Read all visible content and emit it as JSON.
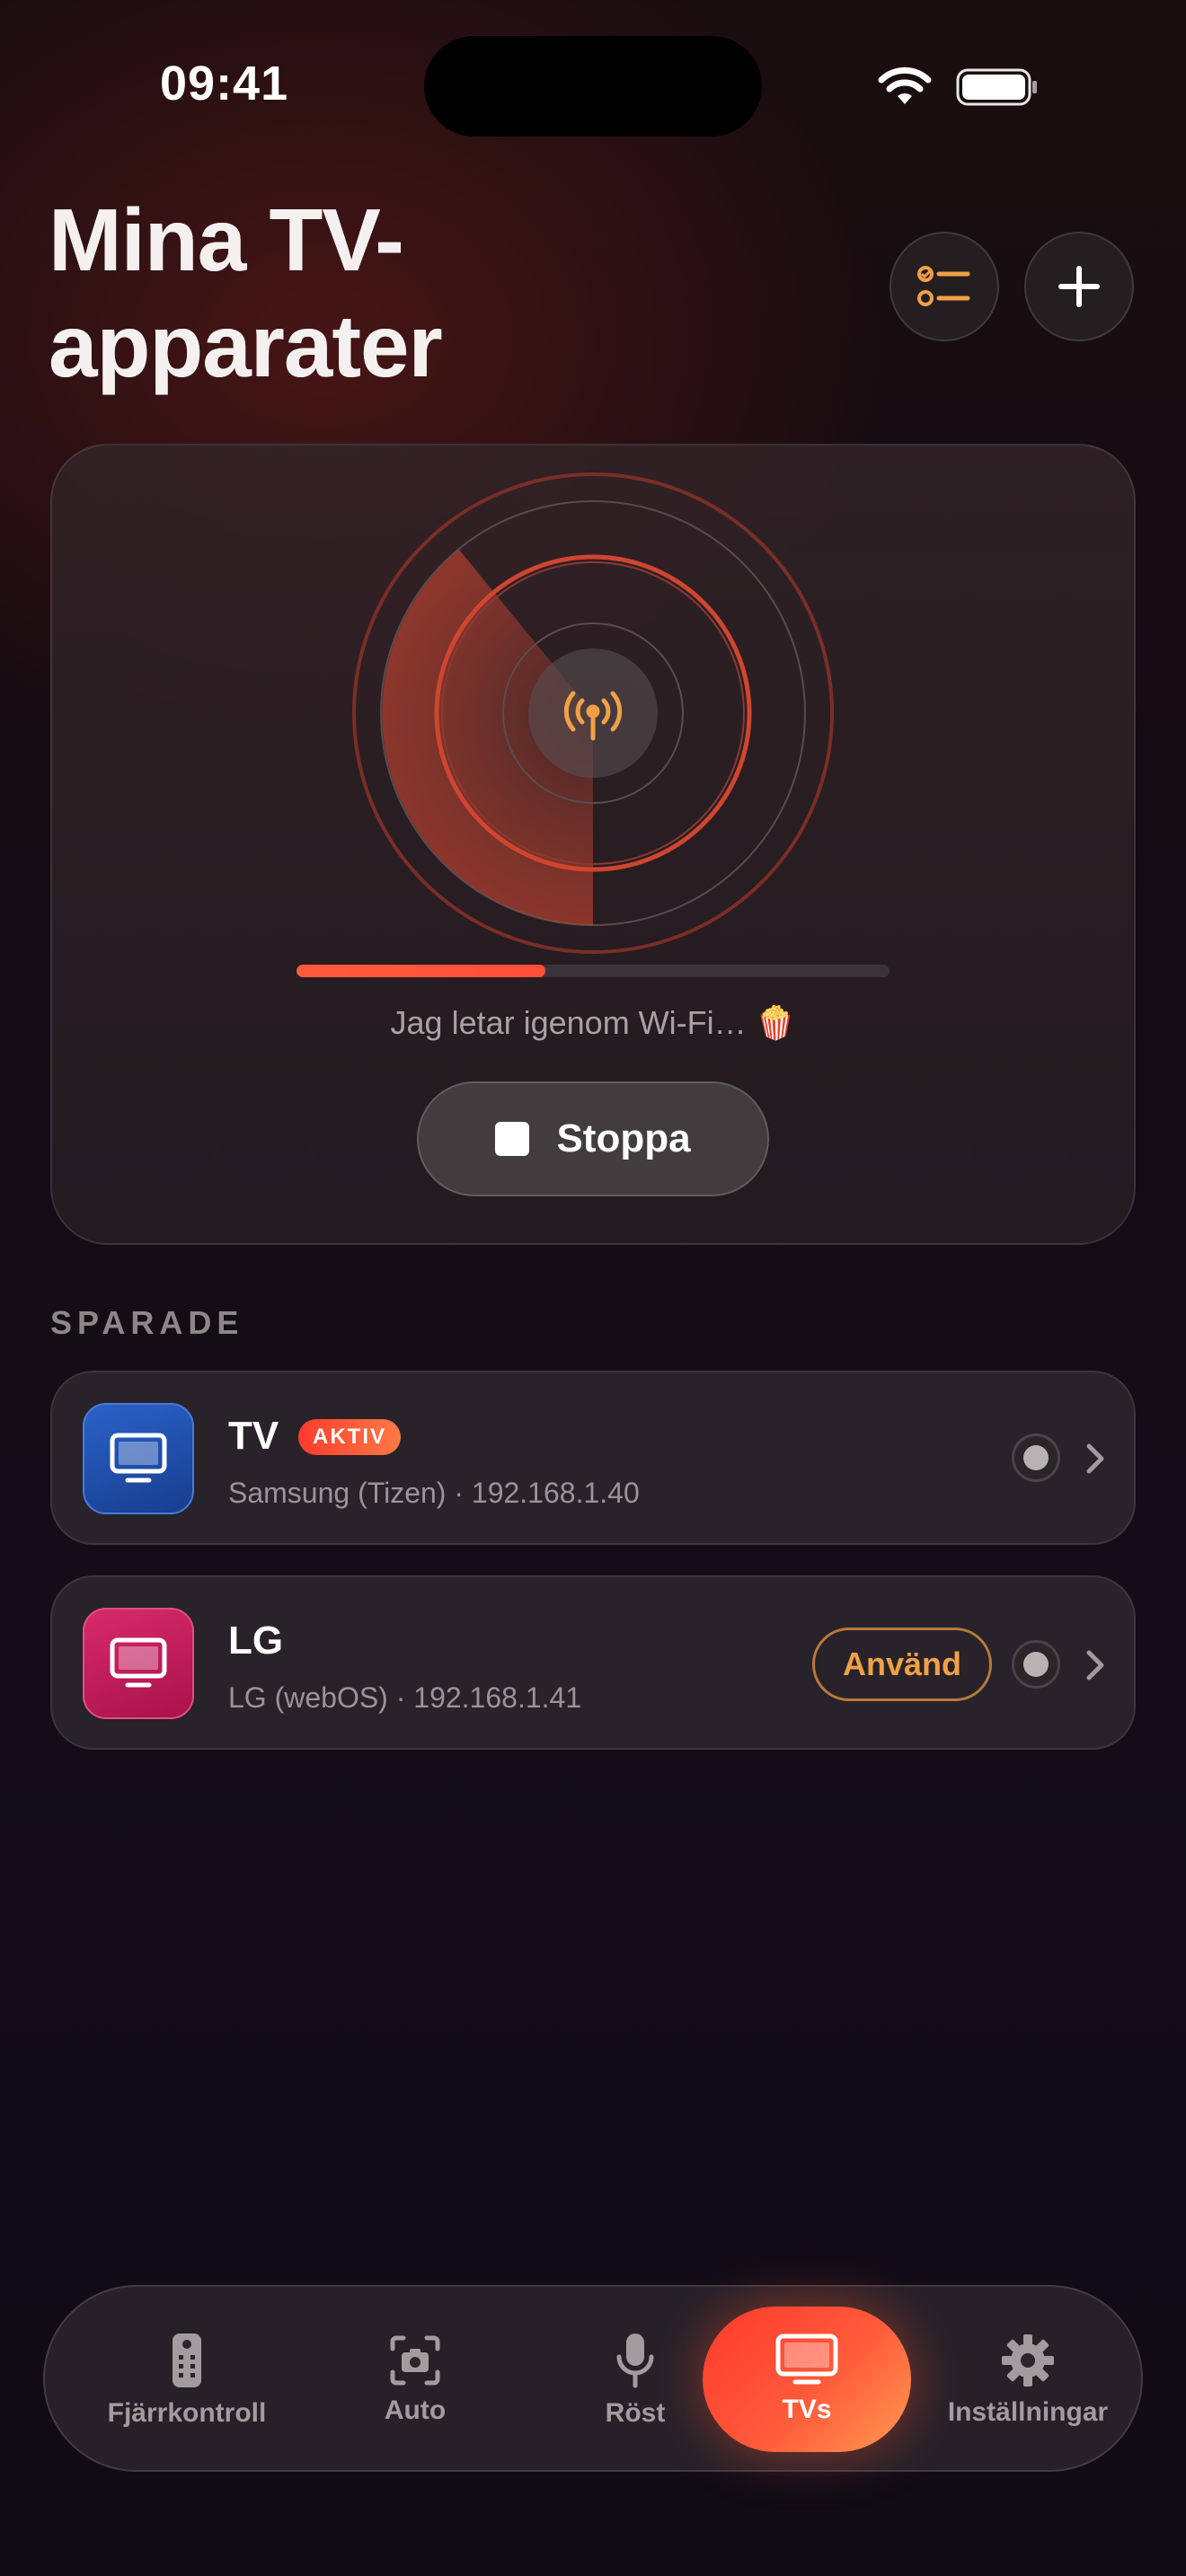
{
  "status_bar": {
    "time": "09:41"
  },
  "header": {
    "title": "Mina TV-apparater"
  },
  "scan": {
    "progress": 0.42,
    "status_text": "Jag letar igenom Wi-Fi… 🍿",
    "stop_label": "Stoppa"
  },
  "saved": {
    "section_label": "SPARADE",
    "devices": [
      {
        "name": "TV",
        "badge": "AKTIV",
        "meta": "Samsung (Tizen) · 192.168.1.40",
        "icon_color": "#1f4fae",
        "icon": "tv-icon"
      },
      {
        "name": "LG",
        "use_label": "Använd",
        "meta": "LG (webOS) · 192.168.1.41",
        "icon_color": "#c2185b",
        "icon": "tv-icon"
      }
    ]
  },
  "tabs": [
    {
      "label": "Fjärrkontroll",
      "icon": "remote-icon"
    },
    {
      "label": "Auto",
      "icon": "camera-scan-icon"
    },
    {
      "label": "Röst",
      "icon": "microphone-icon"
    },
    {
      "label": "TVs",
      "icon": "tv-icon",
      "active": true
    },
    {
      "label": "Inställningar",
      "icon": "gear-icon"
    }
  ],
  "colors": {
    "accent": "#ff4e3a",
    "accent_orange": "#f0a045",
    "background": "#120d18"
  }
}
